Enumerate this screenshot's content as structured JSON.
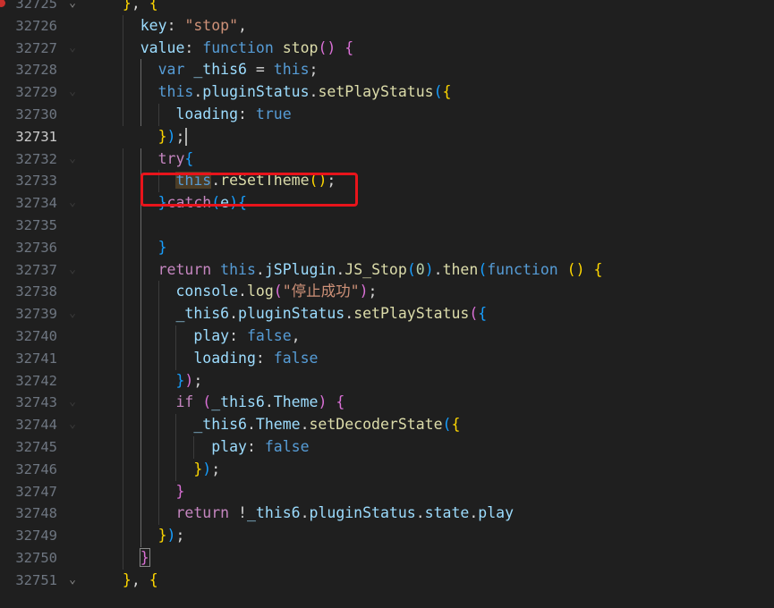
{
  "editor": {
    "breakpoint_line": "32725",
    "current_line": "32731",
    "annotation_color": "#e8141b",
    "lines": [
      {
        "n": "32725",
        "fold": "expanded",
        "tokens": [
          [
            "t-plain",
            "  "
          ],
          [
            "t-b1",
            "}"
          ],
          [
            "t-plain",
            ", "
          ],
          [
            "t-b1",
            "{"
          ]
        ]
      },
      {
        "n": "32726",
        "fold": "",
        "tokens": [
          [
            "t-plain",
            "    "
          ],
          [
            "t-key",
            "key"
          ],
          [
            "t-plain",
            ": "
          ],
          [
            "t-str",
            "\"stop\""
          ],
          [
            "t-plain",
            ","
          ]
        ]
      },
      {
        "n": "32727",
        "fold": "faint",
        "tokens": [
          [
            "t-plain",
            "    "
          ],
          [
            "t-key",
            "value"
          ],
          [
            "t-plain",
            ": "
          ],
          [
            "t-kw",
            "function"
          ],
          [
            "t-plain",
            " "
          ],
          [
            "t-fn",
            "stop"
          ],
          [
            "t-b2",
            "()"
          ],
          [
            "t-plain",
            " "
          ],
          [
            "t-b2",
            "{"
          ]
        ]
      },
      {
        "n": "32728",
        "fold": "",
        "tokens": [
          [
            "t-plain",
            "      "
          ],
          [
            "t-kw",
            "var"
          ],
          [
            "t-plain",
            " "
          ],
          [
            "t-key",
            "_this6"
          ],
          [
            "t-plain",
            " = "
          ],
          [
            "t-kw",
            "this"
          ],
          [
            "t-plain",
            ";"
          ]
        ]
      },
      {
        "n": "32729",
        "fold": "faint",
        "tokens": [
          [
            "t-plain",
            "      "
          ],
          [
            "t-kw",
            "this"
          ],
          [
            "t-plain",
            "."
          ],
          [
            "t-key",
            "pluginStatus"
          ],
          [
            "t-plain",
            "."
          ],
          [
            "t-fn",
            "setPlayStatus"
          ],
          [
            "t-b3",
            "("
          ],
          [
            "t-b1",
            "{"
          ]
        ]
      },
      {
        "n": "32730",
        "fold": "",
        "tokens": [
          [
            "t-plain",
            "        "
          ],
          [
            "t-key",
            "loading"
          ],
          [
            "t-plain",
            ": "
          ],
          [
            "t-kw",
            "true"
          ]
        ]
      },
      {
        "n": "32731",
        "fold": "",
        "tokens": [
          [
            "t-plain",
            "      "
          ],
          [
            "t-b1",
            "}"
          ],
          [
            "t-b3",
            ")"
          ],
          [
            "t-plain",
            ";"
          ]
        ]
      },
      {
        "n": "32732",
        "fold": "faint",
        "tokens": [
          [
            "t-plain",
            "      "
          ],
          [
            "t-ctrl",
            "try"
          ],
          [
            "t-b3",
            "{"
          ]
        ]
      },
      {
        "n": "32733",
        "fold": "",
        "tokens": [
          [
            "t-plain",
            "        "
          ],
          [
            "t-kw word-hl",
            "this"
          ],
          [
            "t-plain",
            "."
          ],
          [
            "t-fn",
            "reSetTheme"
          ],
          [
            "t-b1",
            "()"
          ],
          [
            "t-plain",
            ";"
          ]
        ]
      },
      {
        "n": "32734",
        "fold": "faint",
        "tokens": [
          [
            "t-plain",
            "      "
          ],
          [
            "t-b3",
            "}"
          ],
          [
            "t-ctrl",
            "catch"
          ],
          [
            "t-b3",
            "("
          ],
          [
            "t-key",
            "e"
          ],
          [
            "t-b3",
            ")"
          ],
          [
            "t-b3",
            "{"
          ]
        ]
      },
      {
        "n": "32735",
        "fold": "",
        "tokens": []
      },
      {
        "n": "32736",
        "fold": "",
        "tokens": [
          [
            "t-plain",
            "      "
          ],
          [
            "t-b3",
            "}"
          ]
        ]
      },
      {
        "n": "32737",
        "fold": "faint",
        "tokens": [
          [
            "t-plain",
            "      "
          ],
          [
            "t-ctrl",
            "return"
          ],
          [
            "t-plain",
            " "
          ],
          [
            "t-kw",
            "this"
          ],
          [
            "t-plain",
            "."
          ],
          [
            "t-key",
            "jSPlugin"
          ],
          [
            "t-plain",
            "."
          ],
          [
            "t-fn",
            "JS_Stop"
          ],
          [
            "t-b3",
            "("
          ],
          [
            "t-num",
            "0"
          ],
          [
            "t-b3",
            ")"
          ],
          [
            "t-plain",
            "."
          ],
          [
            "t-fn",
            "then"
          ],
          [
            "t-b3",
            "("
          ],
          [
            "t-kw",
            "function"
          ],
          [
            "t-plain",
            " "
          ],
          [
            "t-b1",
            "()"
          ],
          [
            "t-plain",
            " "
          ],
          [
            "t-b1",
            "{"
          ]
        ]
      },
      {
        "n": "32738",
        "fold": "",
        "tokens": [
          [
            "t-plain",
            "        "
          ],
          [
            "t-key",
            "console"
          ],
          [
            "t-plain",
            "."
          ],
          [
            "t-fn",
            "log"
          ],
          [
            "t-b2",
            "("
          ],
          [
            "t-str",
            "\"停止成功\""
          ],
          [
            "t-b2",
            ")"
          ],
          [
            "t-plain",
            ";"
          ]
        ]
      },
      {
        "n": "32739",
        "fold": "faint",
        "tokens": [
          [
            "t-plain",
            "        "
          ],
          [
            "t-key",
            "_this6"
          ],
          [
            "t-plain",
            "."
          ],
          [
            "t-key",
            "pluginStatus"
          ],
          [
            "t-plain",
            "."
          ],
          [
            "t-fn",
            "setPlayStatus"
          ],
          [
            "t-b2",
            "("
          ],
          [
            "t-b3",
            "{"
          ]
        ]
      },
      {
        "n": "32740",
        "fold": "",
        "tokens": [
          [
            "t-plain",
            "          "
          ],
          [
            "t-key",
            "play"
          ],
          [
            "t-plain",
            ": "
          ],
          [
            "t-kw",
            "false"
          ],
          [
            "t-plain",
            ","
          ]
        ]
      },
      {
        "n": "32741",
        "fold": "",
        "tokens": [
          [
            "t-plain",
            "          "
          ],
          [
            "t-key",
            "loading"
          ],
          [
            "t-plain",
            ": "
          ],
          [
            "t-kw",
            "false"
          ]
        ]
      },
      {
        "n": "32742",
        "fold": "",
        "tokens": [
          [
            "t-plain",
            "        "
          ],
          [
            "t-b3",
            "}"
          ],
          [
            "t-b2",
            ")"
          ],
          [
            "t-plain",
            ";"
          ]
        ]
      },
      {
        "n": "32743",
        "fold": "faint",
        "tokens": [
          [
            "t-plain",
            "        "
          ],
          [
            "t-ctrl",
            "if"
          ],
          [
            "t-plain",
            " "
          ],
          [
            "t-b2",
            "("
          ],
          [
            "t-key",
            "_this6"
          ],
          [
            "t-plain",
            "."
          ],
          [
            "t-key",
            "Theme"
          ],
          [
            "t-b2",
            ")"
          ],
          [
            "t-plain",
            " "
          ],
          [
            "t-b2",
            "{"
          ]
        ]
      },
      {
        "n": "32744",
        "fold": "faint",
        "tokens": [
          [
            "t-plain",
            "          "
          ],
          [
            "t-key",
            "_this6"
          ],
          [
            "t-plain",
            "."
          ],
          [
            "t-key",
            "Theme"
          ],
          [
            "t-plain",
            "."
          ],
          [
            "t-fn",
            "setDecoderState"
          ],
          [
            "t-b3",
            "("
          ],
          [
            "t-b1",
            "{"
          ]
        ]
      },
      {
        "n": "32745",
        "fold": "",
        "tokens": [
          [
            "t-plain",
            "            "
          ],
          [
            "t-key",
            "play"
          ],
          [
            "t-plain",
            ": "
          ],
          [
            "t-kw",
            "false"
          ]
        ]
      },
      {
        "n": "32746",
        "fold": "",
        "tokens": [
          [
            "t-plain",
            "          "
          ],
          [
            "t-b1",
            "}"
          ],
          [
            "t-b3",
            ")"
          ],
          [
            "t-plain",
            ";"
          ]
        ]
      },
      {
        "n": "32747",
        "fold": "",
        "tokens": [
          [
            "t-plain",
            "        "
          ],
          [
            "t-b2",
            "}"
          ]
        ]
      },
      {
        "n": "32748",
        "fold": "",
        "tokens": [
          [
            "t-plain",
            "        "
          ],
          [
            "t-ctrl",
            "return"
          ],
          [
            "t-plain",
            " !"
          ],
          [
            "t-key",
            "_this6"
          ],
          [
            "t-plain",
            "."
          ],
          [
            "t-key",
            "pluginStatus"
          ],
          [
            "t-plain",
            "."
          ],
          [
            "t-key",
            "state"
          ],
          [
            "t-plain",
            "."
          ],
          [
            "t-key",
            "play"
          ]
        ]
      },
      {
        "n": "32749",
        "fold": "",
        "tokens": [
          [
            "t-plain",
            "      "
          ],
          [
            "t-b1",
            "}"
          ],
          [
            "t-b3",
            ")"
          ],
          [
            "t-plain",
            ";"
          ]
        ]
      },
      {
        "n": "32750",
        "fold": "",
        "tokens": [
          [
            "t-plain",
            "    "
          ],
          [
            "t-b2 bracket-box",
            "}"
          ]
        ]
      },
      {
        "n": "32751",
        "fold": "expanded",
        "tokens": [
          [
            "t-plain",
            "  "
          ],
          [
            "t-b1",
            "}"
          ],
          [
            "t-plain",
            ", "
          ],
          [
            "t-b1",
            "{"
          ]
        ]
      }
    ]
  }
}
